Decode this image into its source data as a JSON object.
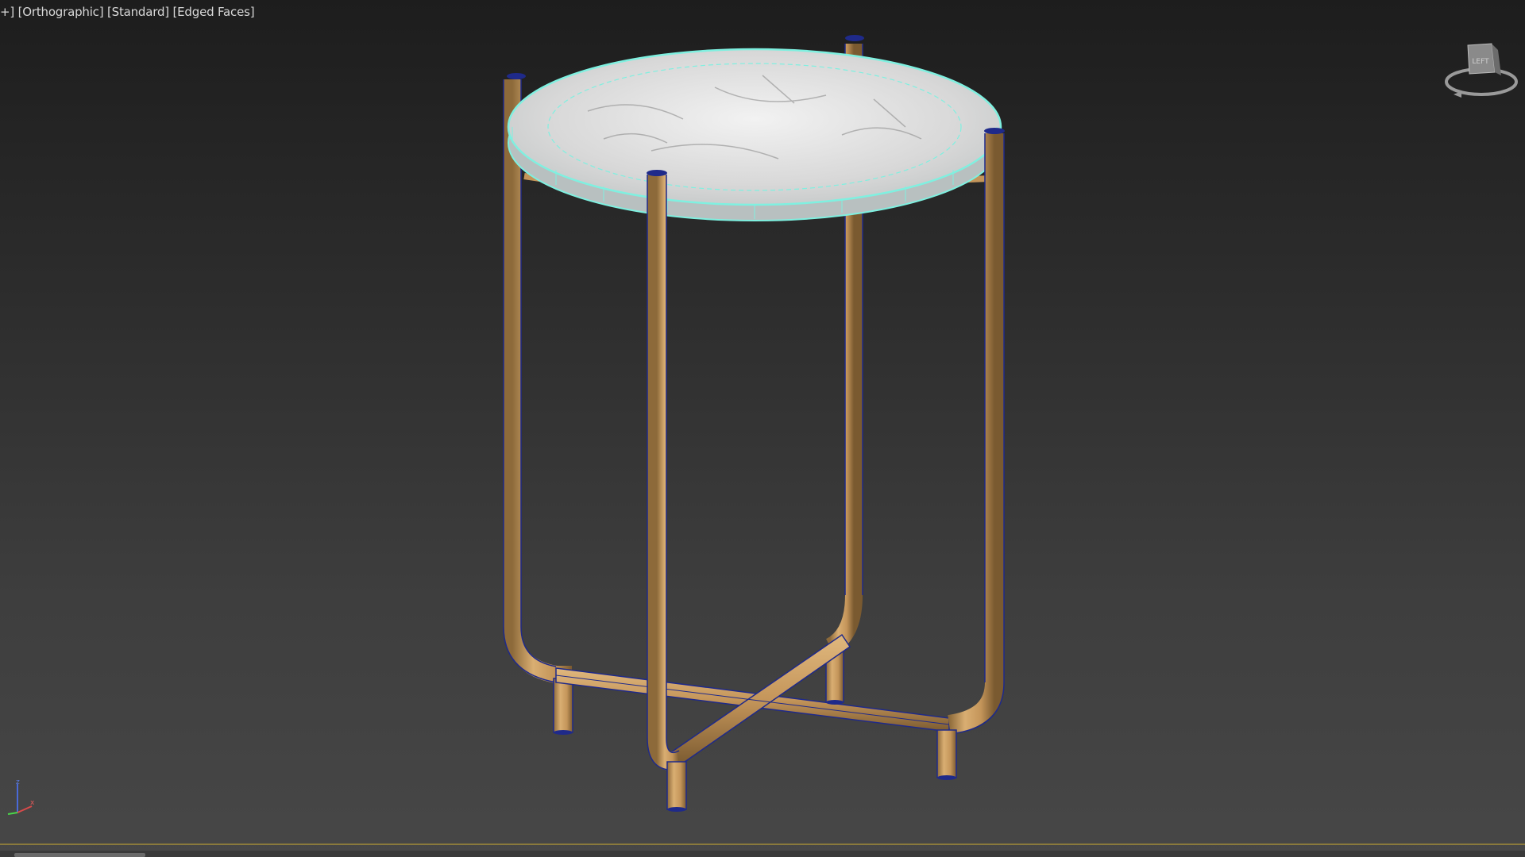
{
  "viewport": {
    "label_plus": "+",
    "label_view": "Orthographic",
    "label_shading": "Standard",
    "label_mode": "Edged Faces"
  },
  "viewcube": {
    "face_label": "LEFT"
  },
  "axis": {
    "z": "z",
    "x": "x"
  },
  "colors": {
    "wire_selected": "#7ff0e0",
    "leg_metal": "#c79a5c",
    "leg_edges": "#1f2a8a",
    "marble": "#e8e8e8"
  }
}
